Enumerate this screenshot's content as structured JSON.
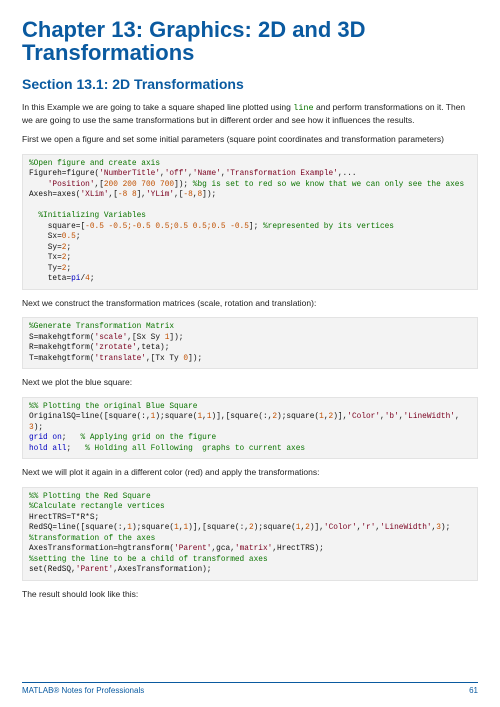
{
  "chapter_title": "Chapter 13: Graphics: 2D and 3D Transformations",
  "section_title": "Section 13.1: 2D Transformations",
  "intro1_a": "In this Example we are going to take a square shaped line plotted using ",
  "intro1_inline": "line",
  "intro1_b": " and perform transformations on it. Then we are going to use the same transformations but in different order and see how it influences the results.",
  "intro2": "First we open a figure and set some initial parameters (square point coordinates and transformation parameters)",
  "para_construct": "Next we construct the transformation matrices (scale, rotation and translation):",
  "para_plot_blue": "Next we plot the blue square:",
  "para_plot_red": "Next we will plot it again in a different color (red) and apply the transformations:",
  "para_result": "The result should look like this:",
  "code1": {
    "l1": "%Open figure and create axis",
    "l2a": "Figureh=figure(",
    "l2s1": "'NumberTitle'",
    "l2c1": ",",
    "l2s2": "'off'",
    "l2c2": ",",
    "l2s3": "'Name'",
    "l2c3": ",",
    "l2s4": "'Transformation Example'",
    "l2e": ",...",
    "l3a": "    ",
    "l3s1": "'Position'",
    "l3c1": ",[",
    "l3n": "200 200 700 700",
    "l3c2": "]); ",
    "l3cm": "%bg is set to red so we know that we can only see the axes",
    "l4a": "Axesh=axes(",
    "l4s1": "'XLim'",
    "l4c1": ",[",
    "l4n1": "-8 8",
    "l4c2": "],",
    "l4s2": "'YLim'",
    "l4c3": ",[",
    "l4n2": "-8",
    "l4c4": ",",
    "l4n3": "8",
    "l4e": "]);",
    "l6": "  %Initializing Variables",
    "l7a": "    square=[",
    "l7n": "-0.5 -0.5;-0.5 0.5;0.5 0.5;0.5 -0.5",
    "l7b": "]; ",
    "l7cm": "%represented by its vertices",
    "l8a": "    Sx=",
    "l8n": "0.5",
    "l8b": ";",
    "l9a": "    Sy=",
    "l9n": "2",
    "l9b": ";",
    "l10a": "    Tx=",
    "l10n": "2",
    "l10b": ";",
    "l11a": "    Ty=",
    "l11n": "2",
    "l11b": ";",
    "l12a": "    teta=",
    "l12k": "pi",
    "l12b": "/",
    "l12n": "4",
    "l12c": ";"
  },
  "code2": {
    "l1": "%Generate Transformation Matrix",
    "l2a": "S=makehgtform(",
    "l2s": "'scale'",
    "l2b": ",[Sx Sy ",
    "l2n": "1",
    "l2c": "]);",
    "l3a": "R=makehgtform(",
    "l3s": "'zrotate'",
    "l3b": ",teta);",
    "l4a": "T=makehgtform(",
    "l4s": "'translate'",
    "l4b": ",[Tx Ty ",
    "l4n": "0",
    "l4c": "]);"
  },
  "code3": {
    "l1": "%% Plotting the original Blue Square",
    "l2a": "OriginalSQ=line([square(:,",
    "l2n1": "1",
    "l2b": ");square(",
    "l2n2": "1",
    "l2c": ",",
    "l2n3": "1",
    "l2d": ")],[square(:,",
    "l2n4": "2",
    "l2e": ");square(",
    "l2n5": "1",
    "l2f": ",",
    "l2n6": "2",
    "l2g": ")],",
    "l2s1": "'Color'",
    "l2h": ",",
    "l2s2": "'b'",
    "l2i": ",",
    "l2s3": "'LineWidth'",
    "l2j": ",",
    "l2n7": "3",
    "l2k": ");",
    "l3a": "grid on",
    "l3b": ";   ",
    "l3cm": "% Applying grid on the figure",
    "l4a": "hold all",
    "l4b": ";   ",
    "l4cm": "% Holding all Following  graphs to current axes"
  },
  "code4": {
    "l1": "%% Plotting the Red Square",
    "l2": "%Calculate rectangle vertices",
    "l3": "HrectTRS=T*R*S;",
    "l4a": "RedSQ=line([square(:,",
    "l4n1": "1",
    "l4b": ");square(",
    "l4n2": "1",
    "l4c": ",",
    "l4n3": "1",
    "l4d": ")],[square(:,",
    "l4n4": "2",
    "l4e": ");square(",
    "l4n5": "1",
    "l4f": ",",
    "l4n6": "2",
    "l4g": ")],",
    "l4s1": "'Color'",
    "l4h": ",",
    "l4s2": "'r'",
    "l4i": ",",
    "l4s3": "'LineWidth'",
    "l4j": ",",
    "l4n7": "3",
    "l4k": ");",
    "l5": "%transformation of the axes",
    "l6a": "AxesTransformation=hgtransform(",
    "l6s1": "'Parent'",
    "l6b": ",gca,",
    "l6s2": "'matrix'",
    "l6c": ",HrectTRS);",
    "l7": "%setting the line to be a child of transformed axes",
    "l8a": "set(RedSQ,",
    "l8s1": "'Parent'",
    "l8b": ",AxesTransformation);"
  },
  "footer_left": "MATLAB® Notes for Professionals",
  "footer_right": "61"
}
